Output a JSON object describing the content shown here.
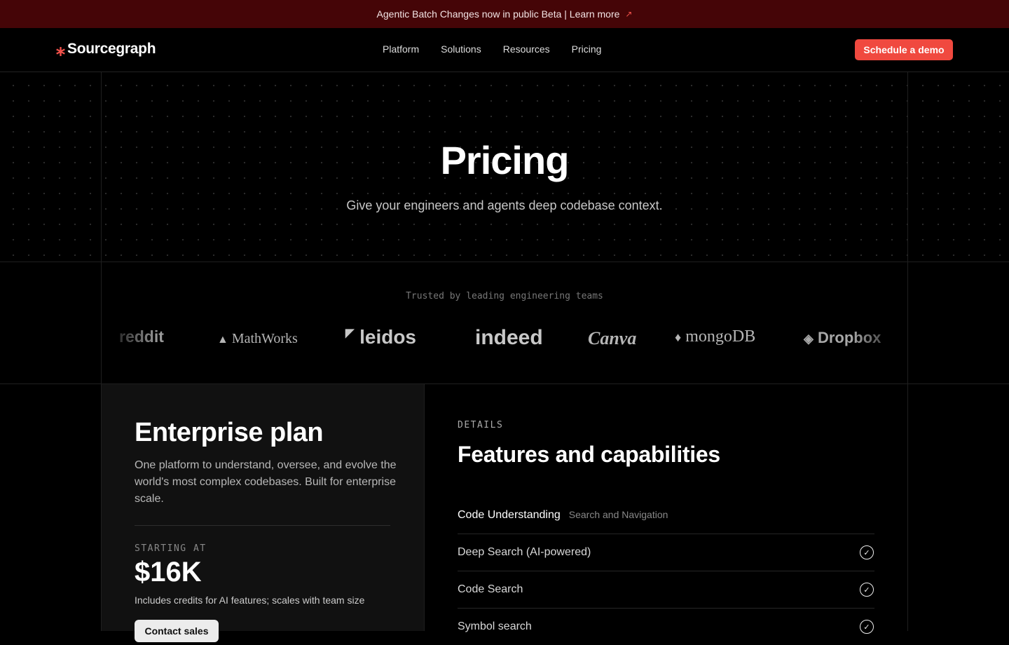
{
  "banner": {
    "text": "Agentic Batch Changes now in public Beta | Learn more",
    "arrow": "↗"
  },
  "nav": {
    "logo_mark": "⁎",
    "logo_text": "Sourcegraph",
    "items": [
      {
        "label": "Platform"
      },
      {
        "label": "Solutions"
      },
      {
        "label": "Resources"
      },
      {
        "label": "Pricing"
      }
    ],
    "cta": "Schedule a demo"
  },
  "hero": {
    "title": "Pricing",
    "subtitle": "Give your engineers and agents deep codebase context."
  },
  "trusted": {
    "label": "Trusted by leading engineering teams",
    "logos": [
      "reddit",
      "MathWorks",
      "leidos",
      "indeed",
      "Canva",
      "mongoDB",
      "Dropbox"
    ]
  },
  "plan": {
    "title": "Enterprise plan",
    "description": "One platform to understand, oversee, and evolve the world's most complex codebases. Built for enterprise scale.",
    "starting_label": "STARTING AT",
    "price": "$16K",
    "includes": "Includes credits for AI features; scales with team size",
    "cta": "Contact sales"
  },
  "details": {
    "eyebrow": "DETAILS",
    "title": "Features and capabilities",
    "category": {
      "name": "Code Understanding",
      "sub": "Search and Navigation"
    },
    "features": [
      {
        "label": "Deep Search (AI-powered)"
      },
      {
        "label": "Code Search"
      },
      {
        "label": "Symbol search"
      }
    ],
    "check_icon": "check-circle-icon"
  },
  "colors": {
    "accent": "#f0493f",
    "banner_bg": "#450507",
    "background": "#000000"
  }
}
